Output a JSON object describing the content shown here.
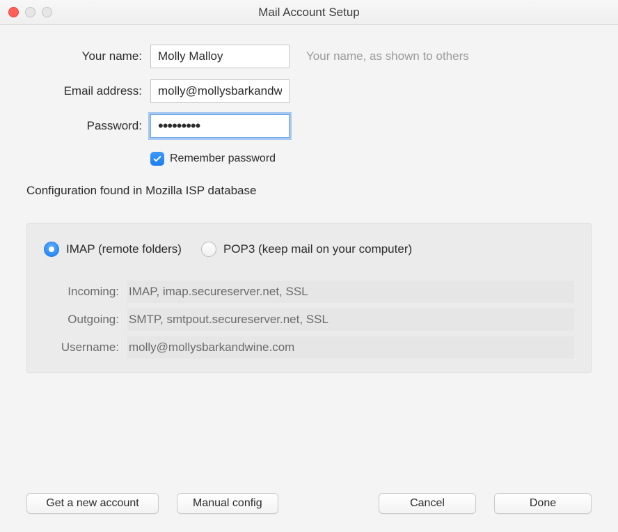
{
  "window": {
    "title": "Mail Account Setup"
  },
  "form": {
    "name_label": "Your name:",
    "name_value": "Molly Malloy",
    "name_hint": "Your name, as shown to others",
    "email_label": "Email address:",
    "email_value": "molly@mollysbarkandwi",
    "password_label": "Password:",
    "password_masked": "•••••••••",
    "remember_label": "Remember password",
    "remember_checked": true
  },
  "status": "Configuration found in Mozilla ISP database",
  "protocol": {
    "imap_label": "IMAP (remote folders)",
    "pop3_label": "POP3 (keep mail on your computer)",
    "selected": "imap"
  },
  "details": {
    "incoming_label": "Incoming:",
    "incoming_value": "IMAP, imap.secureserver.net, SSL",
    "outgoing_label": "Outgoing:",
    "outgoing_value": "SMTP, smtpout.secureserver.net, SSL",
    "username_label": "Username:",
    "username_value": "molly@mollysbarkandwine.com"
  },
  "buttons": {
    "new_account": "Get a new account",
    "manual_config": "Manual config",
    "cancel": "Cancel",
    "done": "Done"
  }
}
